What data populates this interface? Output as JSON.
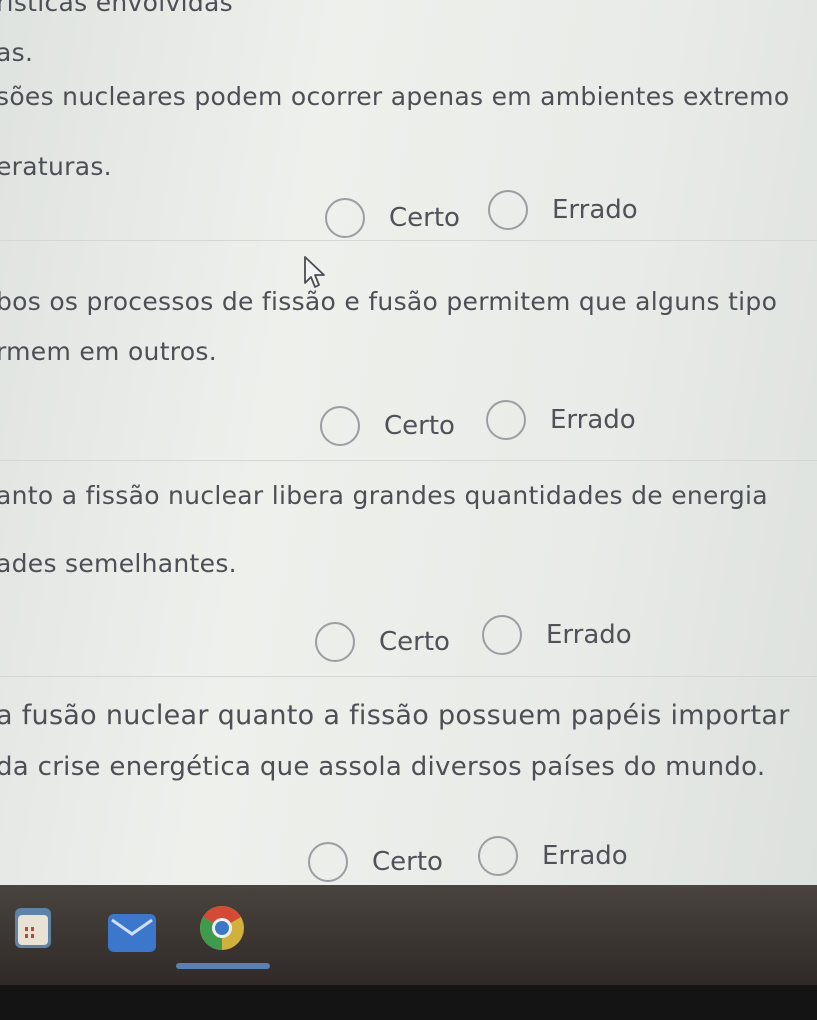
{
  "questions": [
    {
      "lines": [
        "rísticas envolvidas",
        "as."
      ]
    },
    {
      "lines": [
        "sões nucleares podem ocorrer apenas em ambientes extremo",
        "eraturas."
      ],
      "options": {
        "true_label": "Certo",
        "false_label": "Errado"
      }
    },
    {
      "lines": [
        "bos os processos de fissão e fusão permitem que alguns tipo",
        "rmem em outros."
      ],
      "options": {
        "true_label": "Certo",
        "false_label": "Errado"
      }
    },
    {
      "lines": [
        "anto a fissão nuclear libera grandes quantidades de energia",
        "ades semelhantes."
      ],
      "options": {
        "true_label": "Certo",
        "false_label": "Errado"
      }
    },
    {
      "lines": [
        "a fusão nuclear quanto a fissão possuem papéis importar",
        "da crise energética que assola diversos países do mundo."
      ],
      "options": {
        "true_label": "Certo",
        "false_label": "Errado"
      }
    }
  ],
  "taskbar": {
    "apps": [
      {
        "icon": "files-app-icon"
      },
      {
        "icon": "mail-app-icon"
      },
      {
        "icon": "chrome-browser-icon",
        "active": true
      }
    ]
  },
  "colors": {
    "page_background": "#e8ebe7",
    "text": "#4c4f55",
    "radio_border": "#9a9ea3",
    "taskbar": "#3a3431",
    "active_indicator": "#5a7fb2"
  }
}
